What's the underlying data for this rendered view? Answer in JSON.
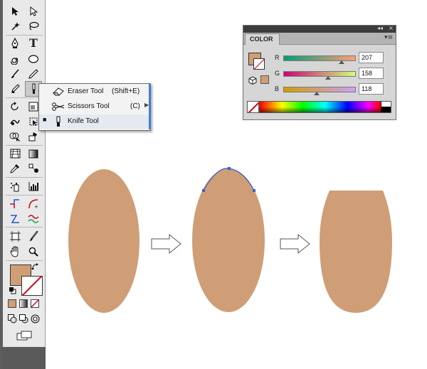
{
  "toolbox": {
    "fill_color": "#cf9e76",
    "tools": [
      {
        "name": "selection-tool",
        "icon": "arrow-icon"
      },
      {
        "name": "direct-selection-tool",
        "icon": "hollow-arrow-icon"
      },
      {
        "name": "magic-wand-tool",
        "icon": "magic-wand-icon"
      },
      {
        "name": "lasso-tool",
        "icon": "lasso-icon"
      },
      {
        "name": "pen-tool",
        "icon": "pen-icon"
      },
      {
        "name": "type-tool",
        "icon": "type-icon"
      },
      {
        "name": "spiral-tool",
        "icon": "spiral-icon"
      },
      {
        "name": "ellipse-tool",
        "icon": "ellipse-icon"
      },
      {
        "name": "paintbrush-tool",
        "icon": "paintbrush-icon"
      },
      {
        "name": "pencil-tool",
        "icon": "pencil-icon"
      },
      {
        "name": "blob-brush-tool",
        "icon": "blob-brush-icon"
      },
      {
        "name": "knife-tool",
        "icon": "knife-icon"
      }
    ],
    "type_glyph": "T"
  },
  "flyout": {
    "items": [
      {
        "label": "Eraser Tool",
        "shortcut": "(Shift+E)",
        "icon": "eraser-icon",
        "selected": false
      },
      {
        "label": "Scissors Tool",
        "shortcut": "(C)",
        "icon": "scissors-icon",
        "selected": false
      },
      {
        "label": "Knife Tool",
        "shortcut": "",
        "icon": "knife-icon",
        "selected": true
      }
    ],
    "check_glyph": "■",
    "arrow_glyph": "▶"
  },
  "color_panel": {
    "title": "COLOR",
    "close_glyph": "×",
    "collapse_glyph": "◂◂",
    "panel_close_glyph": "×",
    "menu_glyph": "▾≡",
    "channels": [
      {
        "letter": "R",
        "value": "207",
        "fraction": 0.81
      },
      {
        "letter": "G",
        "value": "158",
        "fraction": 0.62
      },
      {
        "letter": "B",
        "value": "118",
        "fraction": 0.46
      }
    ],
    "fill_color": "#cf9e76"
  },
  "canvas": {
    "shape_color": "#cf9e76",
    "path_color": "#3a5fcd",
    "arrow_stroke": "#555555"
  }
}
